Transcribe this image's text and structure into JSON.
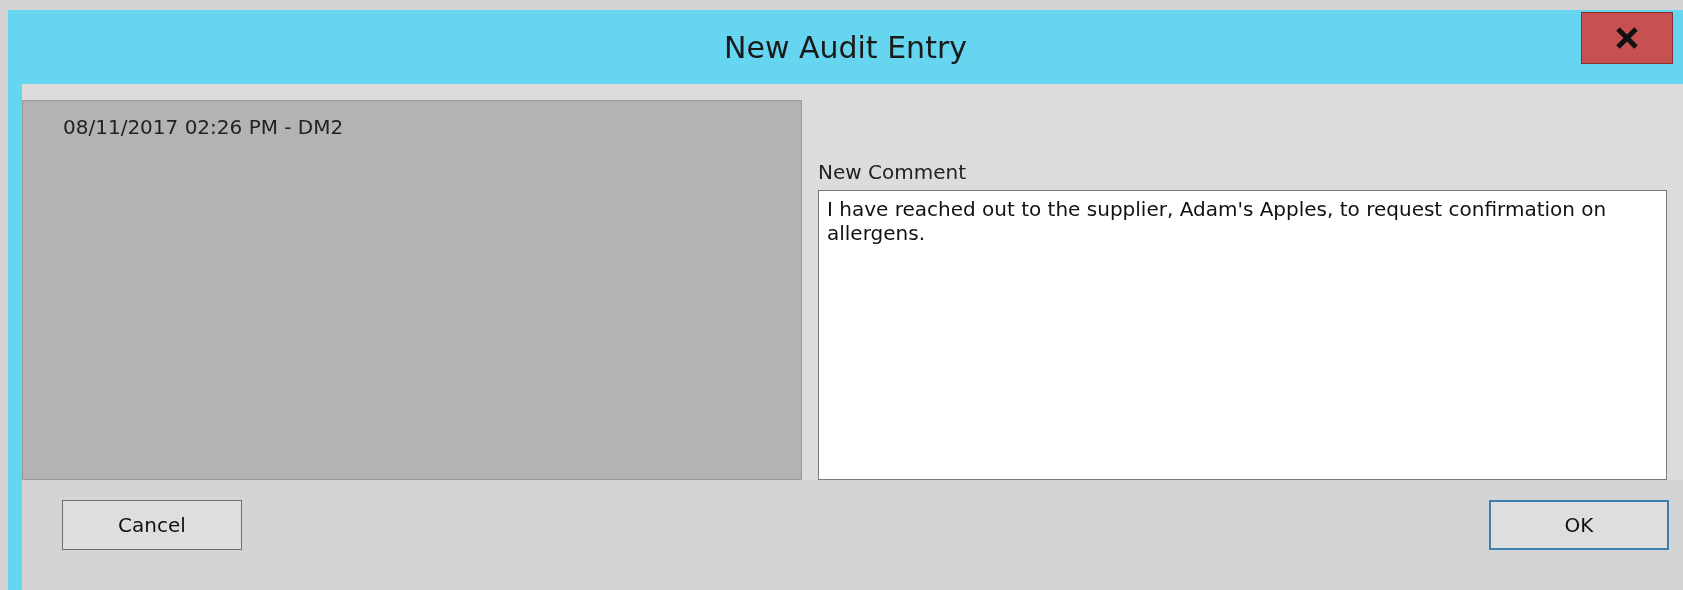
{
  "window": {
    "title": "New Audit Entry"
  },
  "history": {
    "entry": "08/11/2017 02:26 PM - DM2"
  },
  "comment": {
    "label": "New Comment",
    "value": "I have reached out to the supplier, Adam's Apples, to request confirmation on allergens."
  },
  "buttons": [
    {
      "label": "Cancel",
      "kind": "secondary"
    },
    {
      "label": "OK",
      "kind": "primary"
    }
  ]
}
